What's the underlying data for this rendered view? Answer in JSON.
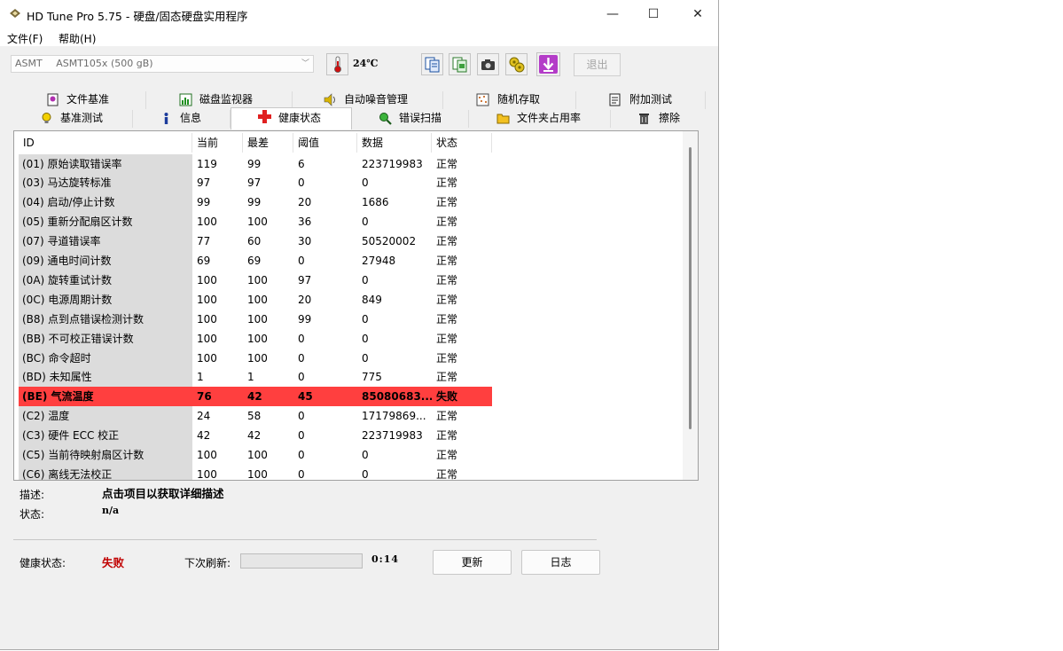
{
  "window": {
    "title": "HD Tune Pro 5.75 - 硬盘/固态硬盘实用程序",
    "minimize_glyph": "—",
    "maximize_glyph": "☐",
    "close_glyph": "✕"
  },
  "menu": [
    "文件(F)",
    "帮助(H)"
  ],
  "toolbar": {
    "drive_vendor": "ASMT",
    "drive_model": "ASMT105x (500 gB)",
    "temperature": "24℃",
    "icons": [
      "copy-text-icon",
      "copy-screen-icon",
      "camera-icon",
      "options-icon",
      "save-icon"
    ],
    "exit_label": "退出"
  },
  "tabs_row1": [
    {
      "label": "文件基准",
      "icon": "file-benchmark-icon"
    },
    {
      "label": "磁盘监视器",
      "icon": "disk-monitor-icon"
    },
    {
      "label": "自动噪音管理",
      "icon": "speaker-icon"
    },
    {
      "label": "随机存取",
      "icon": "random-access-icon"
    },
    {
      "label": "附加测试",
      "icon": "extra-tests-icon"
    }
  ],
  "tabs_row2": [
    {
      "label": "基准测试",
      "icon": "lightbulb-icon"
    },
    {
      "label": "信息",
      "icon": "info-icon"
    },
    {
      "label": "健康状态",
      "icon": "red-cross-icon",
      "active": true
    },
    {
      "label": "错误扫描",
      "icon": "magnifier-icon"
    },
    {
      "label": "文件夹占用率",
      "icon": "folder-icon"
    },
    {
      "label": "擦除",
      "icon": "trash-icon"
    }
  ],
  "table": {
    "columns": [
      "ID",
      "当前",
      "最差",
      "阈值",
      "数据",
      "状态"
    ],
    "rows": [
      [
        "(01) 原始读取错误率",
        "119",
        "99",
        "6",
        "223719983",
        "正常"
      ],
      [
        "(03) 马达旋转标准",
        "97",
        "97",
        "0",
        "0",
        "正常"
      ],
      [
        "(04) 启动/停止计数",
        "99",
        "99",
        "20",
        "1686",
        "正常"
      ],
      [
        "(05) 重新分配扇区计数",
        "100",
        "100",
        "36",
        "0",
        "正常"
      ],
      [
        "(07) 寻道错误率",
        "77",
        "60",
        "30",
        "50520002",
        "正常"
      ],
      [
        "(09) 通电时间计数",
        "69",
        "69",
        "0",
        "27948",
        "正常"
      ],
      [
        "(0A) 旋转重试计数",
        "100",
        "100",
        "97",
        "0",
        "正常"
      ],
      [
        "(0C) 电源周期计数",
        "100",
        "100",
        "20",
        "849",
        "正常"
      ],
      [
        "(B8) 点到点错误检测计数",
        "100",
        "100",
        "99",
        "0",
        "正常"
      ],
      [
        "(BB) 不可校正错误计数",
        "100",
        "100",
        "0",
        "0",
        "正常"
      ],
      [
        "(BC) 命令超时",
        "100",
        "100",
        "0",
        "0",
        "正常"
      ],
      [
        "(BD) 未知属性",
        "1",
        "1",
        "0",
        "775",
        "正常"
      ],
      [
        "(BE) 气流温度",
        "76",
        "42",
        "45",
        "85080683...",
        "失败"
      ],
      [
        "(C2) 温度",
        "24",
        "58",
        "0",
        "17179869...",
        "正常"
      ],
      [
        "(C3) 硬件 ECC 校正",
        "42",
        "42",
        "0",
        "223719983",
        "正常"
      ],
      [
        "(C5) 当前待映射扇区计数",
        "100",
        "100",
        "0",
        "0",
        "正常"
      ],
      [
        "(C6) 离线无法校正",
        "100",
        "100",
        "0",
        "0",
        "正常"
      ]
    ],
    "failed_row_color": "#ff3f3f"
  },
  "details": {
    "description_label": "描述:",
    "description_value": "点击项目以获取详细描述",
    "status_label": "状态:",
    "status_value": "n/a"
  },
  "footer": {
    "health_label": "健康状态:",
    "health_value": "失败",
    "health_color": "#c00000",
    "refresh_label": "下次刷新:",
    "countdown": "0:14",
    "refresh_progress": 0,
    "update_button": "更新",
    "log_button": "日志"
  }
}
